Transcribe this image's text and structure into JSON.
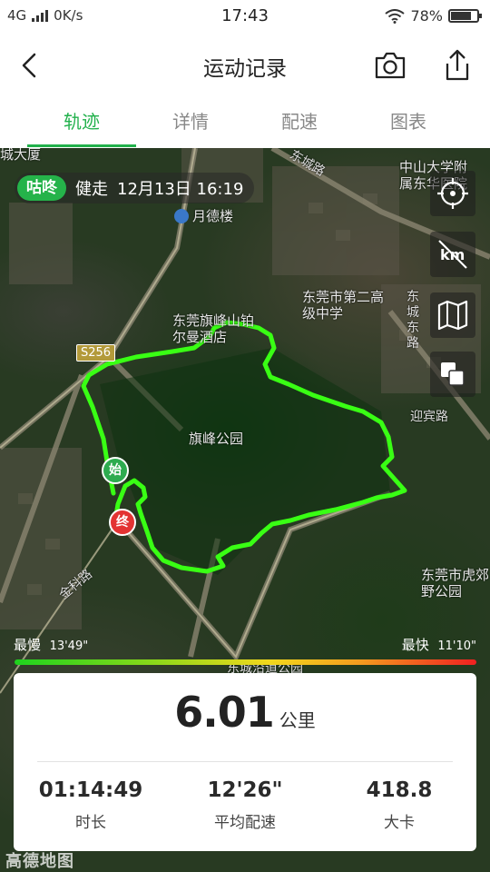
{
  "status_bar": {
    "network": "4G",
    "speed": "0K/s",
    "time": "17:43",
    "battery": "78%",
    "battery_level": 0.78
  },
  "header": {
    "title": "运动记录",
    "back_icon": "chevron-left-icon",
    "camera_icon": "camera-icon",
    "share_icon": "share-icon"
  },
  "tabs": [
    {
      "label": "轨迹",
      "active": true
    },
    {
      "label": "详情",
      "active": false
    },
    {
      "label": "配速",
      "active": false
    },
    {
      "label": "图表",
      "active": false
    }
  ],
  "activity": {
    "brand": "咕咚",
    "type": "健走",
    "datetime": "12月13日 16:19"
  },
  "map_labels": {
    "moon_building": "月德楼",
    "hotel": "东莞旗峰山铂尔曼酒店",
    "school": "东莞市第二高级中学",
    "park": "旗峰公园",
    "university": "中山大学附属东华医院",
    "zoo": "东莞市虎郊野公园",
    "road_dongcheng": "东城东路",
    "road_yingbin": "迎宾路",
    "road_jinke": "金科路",
    "road_dongguan": "东城路",
    "road_top": "东城路",
    "road_bottom": "东城沿道公园",
    "road_s256": "S256",
    "corner_top": "城大厦"
  },
  "map_controls": [
    {
      "icon": "locate-icon"
    },
    {
      "icon": "km-off-icon"
    },
    {
      "icon": "map-icon"
    },
    {
      "icon": "layers-icon"
    }
  ],
  "markers": {
    "start": "始",
    "end": "终"
  },
  "pace_scale": {
    "slow_label": "最慢",
    "slow_value": "13'49\"",
    "fast_label": "最快",
    "fast_value": "11'10\""
  },
  "summary": {
    "distance": "6.01",
    "distance_unit": "公里",
    "duration": "01:14:49",
    "duration_label": "时长",
    "avg_pace": "12'26\"",
    "avg_pace_label": "平均配速",
    "calories": "418.8",
    "calories_label": "大卡"
  },
  "watermark": "高德地图",
  "colors": {
    "accent": "#22b14c",
    "route": "#39ff14",
    "start_marker": "#2dab4f",
    "end_marker": "#e33333"
  }
}
